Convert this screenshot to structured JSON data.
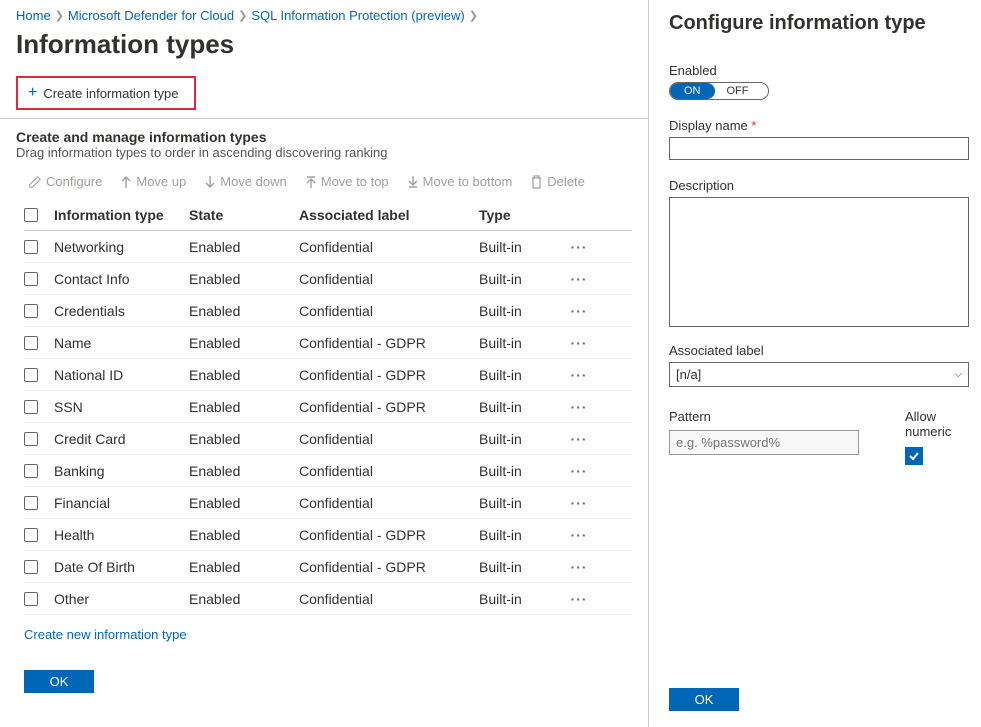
{
  "breadcrumb": {
    "home": "Home",
    "defender": "Microsoft Defender for Cloud",
    "sql": "SQL Information Protection (preview)"
  },
  "page_title": "Information types",
  "create_button": "Create information type",
  "section": {
    "title": "Create and manage information types",
    "subtitle": "Drag information types to order in ascending discovering ranking"
  },
  "actions": {
    "configure": "Configure",
    "move_up": "Move up",
    "move_down": "Move down",
    "move_top": "Move to top",
    "move_bottom": "Move to bottom",
    "delete": "Delete"
  },
  "table": {
    "headers": {
      "c1": "Information type",
      "c2": "State",
      "c3": "Associated label",
      "c4": "Type"
    },
    "rows": [
      {
        "name": "Networking",
        "state": "Enabled",
        "label": "Confidential",
        "type": "Built-in"
      },
      {
        "name": "Contact Info",
        "state": "Enabled",
        "label": "Confidential",
        "type": "Built-in"
      },
      {
        "name": "Credentials",
        "state": "Enabled",
        "label": "Confidential",
        "type": "Built-in"
      },
      {
        "name": "Name",
        "state": "Enabled",
        "label": "Confidential - GDPR",
        "type": "Built-in"
      },
      {
        "name": "National ID",
        "state": "Enabled",
        "label": "Confidential - GDPR",
        "type": "Built-in"
      },
      {
        "name": "SSN",
        "state": "Enabled",
        "label": "Confidential - GDPR",
        "type": "Built-in"
      },
      {
        "name": "Credit Card",
        "state": "Enabled",
        "label": "Confidential",
        "type": "Built-in"
      },
      {
        "name": "Banking",
        "state": "Enabled",
        "label": "Confidential",
        "type": "Built-in"
      },
      {
        "name": "Financial",
        "state": "Enabled",
        "label": "Confidential",
        "type": "Built-in"
      },
      {
        "name": "Health",
        "state": "Enabled",
        "label": "Confidential - GDPR",
        "type": "Built-in"
      },
      {
        "name": "Date Of Birth",
        "state": "Enabled",
        "label": "Confidential - GDPR",
        "type": "Built-in"
      },
      {
        "name": "Other",
        "state": "Enabled",
        "label": "Confidential",
        "type": "Built-in"
      }
    ]
  },
  "create_link": "Create new information type",
  "ok_label": "OK",
  "panel": {
    "title": "Configure information type",
    "enabled_label": "Enabled",
    "toggle_on": "ON",
    "toggle_off": "OFF",
    "display_name": "Display name",
    "description": "Description",
    "assoc_label": "Associated label",
    "assoc_value": "[n/a]",
    "pattern_label": "Pattern",
    "pattern_placeholder": "e.g. %password%",
    "allow_numeric": "Allow numeric"
  }
}
